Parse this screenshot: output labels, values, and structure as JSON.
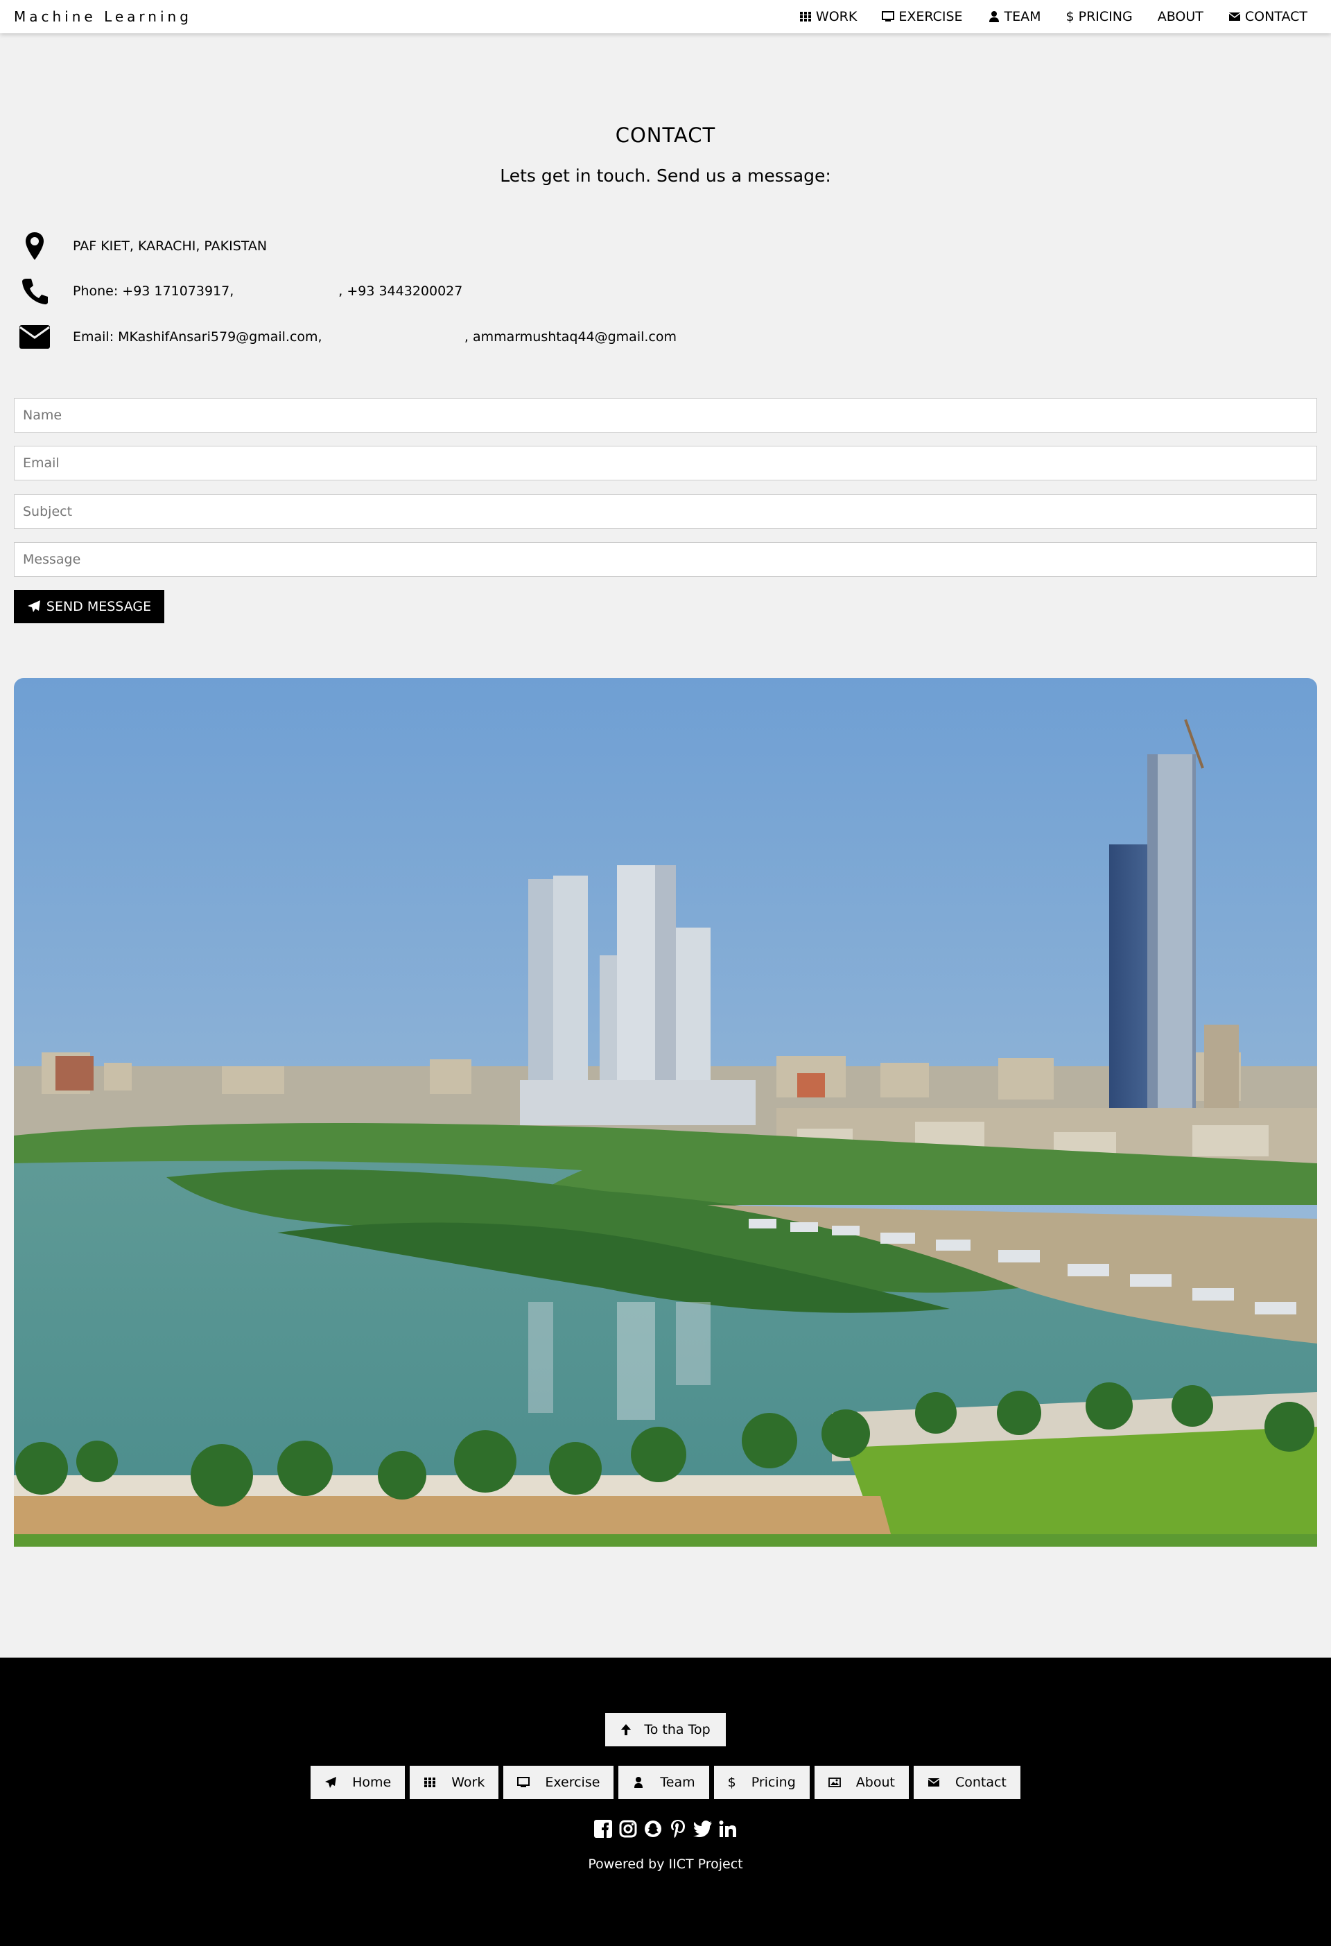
{
  "brand": "Machine Learning",
  "nav": [
    {
      "label": "WORK",
      "icon": "grid-icon"
    },
    {
      "label": "EXERCISE",
      "icon": "desktop-icon"
    },
    {
      "label": "TEAM",
      "icon": "user-icon"
    },
    {
      "label": "PRICING",
      "icon": "dollar-icon"
    },
    {
      "label": "ABOUT",
      "icon": ""
    },
    {
      "label": "CONTACT",
      "icon": "envelope-icon"
    }
  ],
  "contact": {
    "title": "CONTACT",
    "subtitle": "Lets get in touch. Send us a message:",
    "address": "PAF KIET, KARACHI, PAKISTAN",
    "phone": "Phone: +93 171073917,                         , +93 3443200027",
    "email": "Email: MKashifAnsari579@gmail.com,                                  , ammarmushtaq44@gmail.com"
  },
  "form": {
    "name_placeholder": "Name",
    "email_placeholder": "Email",
    "subject_placeholder": "Subject",
    "message_placeholder": "Message",
    "send_label": "SEND MESSAGE"
  },
  "footer": {
    "top_label": "To tha Top",
    "nav": [
      "Home",
      "Work",
      "Exercise",
      "Team",
      "Pricing",
      "About",
      "Contact"
    ],
    "social": [
      "facebook-icon",
      "instagram-icon",
      "snapchat-icon",
      "pinterest-icon",
      "twitter-icon",
      "linkedin-icon"
    ],
    "powered": "Powered by IICT Project"
  },
  "colors": {
    "background": "#f1f1f1",
    "footer_bg": "#000000",
    "button_bg": "#000000",
    "navbar_bg": "#ffffff"
  }
}
